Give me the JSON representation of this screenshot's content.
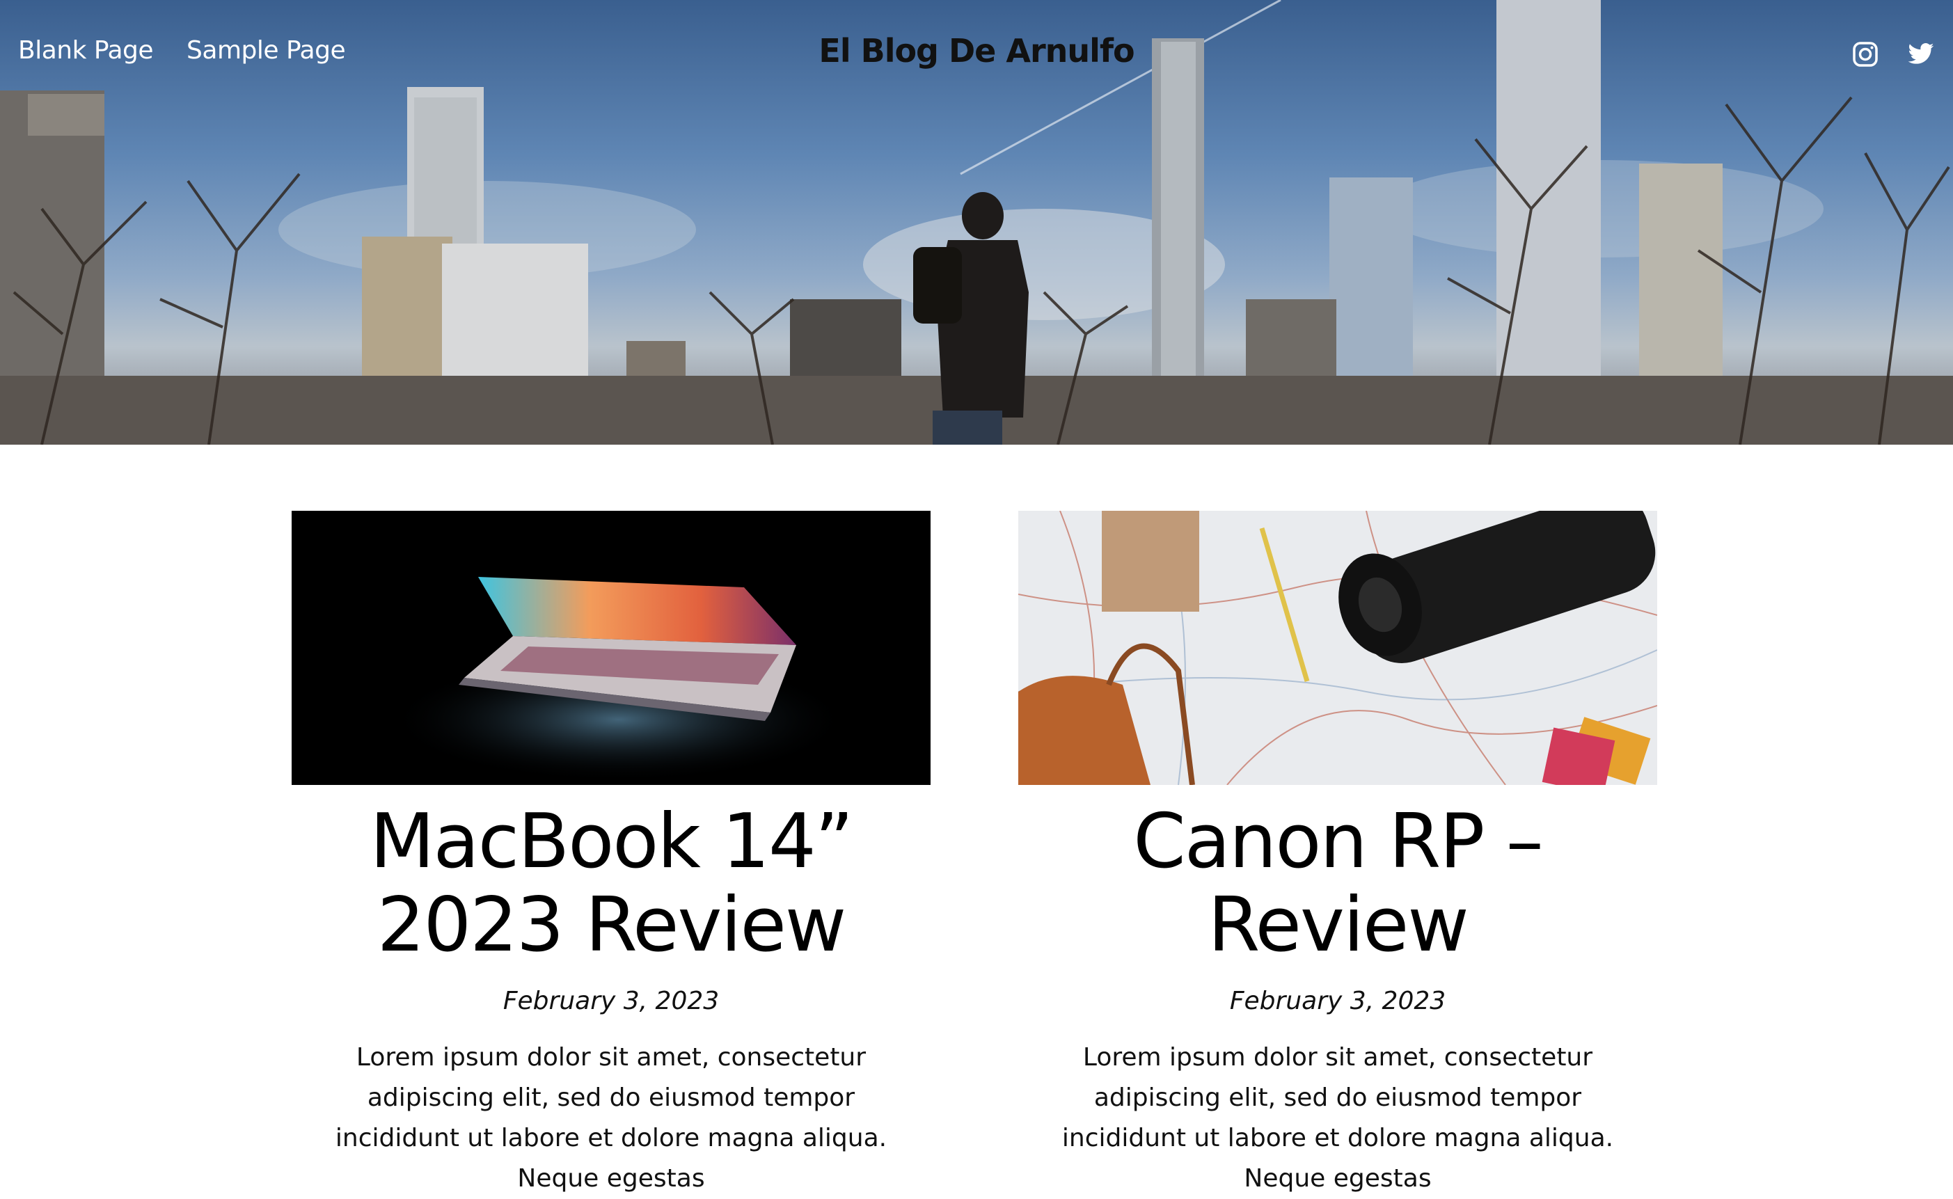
{
  "header": {
    "site_title": "El Blog De Arnulfo",
    "nav": [
      {
        "label": "Blank Page"
      },
      {
        "label": "Sample Page"
      }
    ],
    "social": [
      {
        "icon": "instagram-icon"
      },
      {
        "icon": "twitter-icon"
      }
    ]
  },
  "posts": [
    {
      "title_line1": "MacBook 14”",
      "title_line2": "2023 Review",
      "date": "February 3, 2023",
      "excerpt": "Lorem ipsum dolor sit amet, consectetur adipiscing elit, sed do eiusmod tempor incididunt ut labore et dolore magna aliqua. Neque egestas"
    },
    {
      "title_line1": "Canon RP –",
      "title_line2": "Review",
      "date": "February 3, 2023",
      "excerpt": "Lorem ipsum dolor sit amet, consectetur adipiscing elit, sed do eiusmod tempor incididunt ut labore et dolore magna aliqua. Neque egestas"
    }
  ],
  "colors": {
    "sky": "#5f86b4",
    "text": "#000000",
    "background": "#ffffff"
  }
}
